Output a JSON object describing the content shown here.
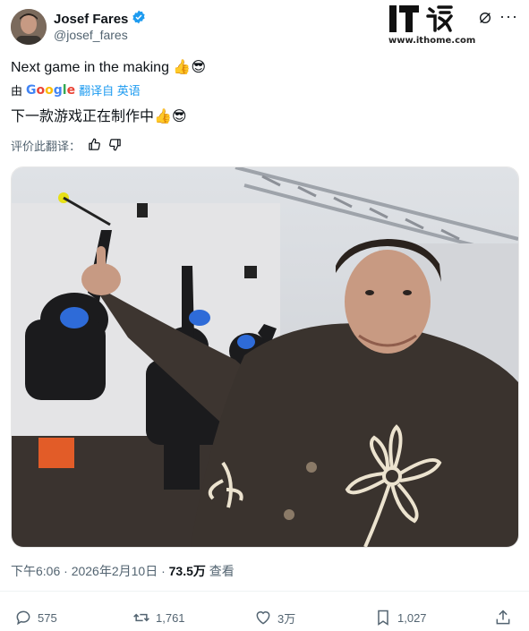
{
  "author": {
    "name": "Josef Fares",
    "handle": "@josef_fares",
    "verified_icon": "verified-badge-icon"
  },
  "watermark": {
    "site": "www.ithome.com"
  },
  "tweet": {
    "text": "Next game in the making 👍😎",
    "translated_by": {
      "prefix": "由",
      "provider": "Google",
      "link_text": "翻译自 英语"
    },
    "translation": "下一款游戏正在制作中👍😎",
    "rate_label": "评价此翻译："
  },
  "meta": {
    "time": "下午6:06 · 2026年2月10日 · ",
    "views": "73.5万",
    "views_label": " 查看"
  },
  "actions": {
    "replies": "575",
    "reposts": "1,761",
    "likes": "3万",
    "bookmarks": "1,027"
  },
  "colors": {
    "accent": "#1d9bf0",
    "muted": "#536471",
    "text": "#0f1419"
  }
}
